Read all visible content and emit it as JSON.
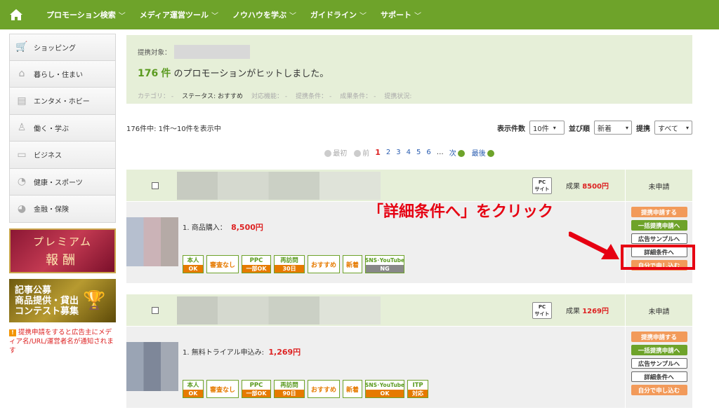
{
  "nav": {
    "items": [
      "プロモーション検索",
      "メディア運営ツール",
      "ノウハウを学ぶ",
      "ガイドライン",
      "サポート"
    ]
  },
  "sidebar": {
    "categories": [
      "ショッピング",
      "暮らし・住まい",
      "エンタメ・ホビー",
      "働く・学ぶ",
      "ビジネス",
      "健康・スポーツ",
      "金融・保険"
    ],
    "banner1": [
      "プレミアム",
      "報酬"
    ],
    "banner2": [
      "記事公募",
      "商品提供・貸出",
      "コンテスト募集"
    ],
    "notice": "提携申請をすると広告主にメディア名/URL/運営者名が通知されます"
  },
  "summary": {
    "target_label": "提携対象：",
    "hit_count": "176",
    "hit_unit": "件",
    "hit_text": "のプロモーションがヒットしました。",
    "filters": {
      "category": "カテゴリ： -",
      "status_label": "ステータス:",
      "status_value": "おすすめ",
      "function": "対応機能： -",
      "condition": "提携条件： -",
      "result": "成果条件： -",
      "state": "提携状況:"
    }
  },
  "listbar": {
    "count_text": "176件中: 1件〜10件を表示中",
    "per_page_label": "表示件数",
    "per_page_value": "10件",
    "sort_label": "並び順",
    "sort_value": "新着",
    "partner_label": "提携",
    "partner_value": "すべて"
  },
  "pager": {
    "first": "最初",
    "prev": "前",
    "current": "1",
    "pages": [
      "2",
      "3",
      "4",
      "5",
      "6"
    ],
    "ellipsis": "…",
    "next": "次",
    "last": "最後"
  },
  "cards": [
    {
      "pc_badge": [
        "PC",
        "サイト"
      ],
      "reward_label": "成果",
      "reward_value": "8500円",
      "status": "未申請",
      "product_label": "1. 商品購入：",
      "product_value": "8,500円",
      "tags": {
        "honnin": [
          "本人",
          "OK"
        ],
        "shinsa": "審査なし",
        "ppc": [
          "PPC",
          "一部OK"
        ],
        "revisit": [
          "再訪問",
          "30日"
        ],
        "osusume": "おすすめ",
        "shinchaku": "新着",
        "sns": [
          "SNS･YouTube",
          "NG"
        ]
      },
      "actions": [
        "提携申請する",
        "一括提携申請へ",
        "広告サンプルへ",
        "詳細条件へ",
        "自分で申し込む"
      ]
    },
    {
      "pc_badge": [
        "PC",
        "サイト"
      ],
      "reward_label": "成果",
      "reward_value": "1269円",
      "status": "未申請",
      "product_label": "1. 無料トライアル申込み:",
      "product_value": "1,269円",
      "tags": {
        "honnin": [
          "本人",
          "OK"
        ],
        "shinsa": "審査なし",
        "ppc": [
          "PPC",
          "一部OK"
        ],
        "revisit": [
          "再訪問",
          "90日"
        ],
        "osusume": "おすすめ",
        "shinchaku": "新着",
        "sns": [
          "SNS･YouTube",
          "OK"
        ],
        "itp": [
          "ITP",
          "対応"
        ]
      },
      "actions": [
        "提携申請する",
        "一括提携申請へ",
        "広告サンプルへ",
        "詳細条件へ",
        "自分で申し込む"
      ]
    }
  ],
  "annotation": {
    "callout": "「詳細条件へ」をクリック"
  },
  "colors": {
    "brand_green": "#6ea32a",
    "panel_green": "#e6efd8",
    "accent_red": "#e60012",
    "orange": "#f29a5a"
  }
}
